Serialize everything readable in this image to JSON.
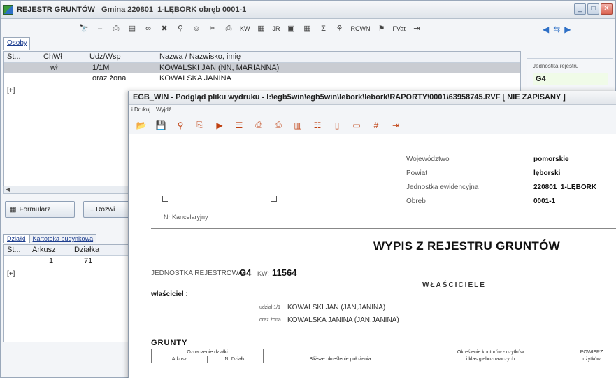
{
  "back_window": {
    "title": "REJESTR GRUNTÓW",
    "title_sub": "Gmina 220801_1-LĘBORK obręb 0001-1",
    "tab_osoby": "Osoby",
    "toolbar": {
      "kw_label": "KW",
      "jr_label": "JR",
      "rcwn_label": "RCWN",
      "fvat_label": "FVat"
    },
    "grid_columns": [
      "St...",
      "ChWł",
      "Udz/Wsp",
      "Nazwa / Nazwisko, imię"
    ],
    "grid_rows": [
      {
        "st": "",
        "chwl": "wł",
        "udz": "1/1M",
        "name": "KOWALSKI JAN (NN, MARIANNA)",
        "selected": true
      },
      {
        "st": "",
        "chwl": "",
        "udz": "oraz żona",
        "name": "KOWALSKA JANINA",
        "selected": false
      }
    ],
    "expand_marker": "[+]",
    "side_label": "Jednostka rejestru",
    "side_value": "G4",
    "btn_formularz": "Formularz",
    "btn_rozwin": "... Rozwi",
    "tabs2": [
      "Działki",
      "Kartoteka budynkowa"
    ],
    "grid2_columns": [
      "St...",
      "Arkusz",
      "Działka"
    ],
    "grid2_row": {
      "st": "",
      "arkusz": "1",
      "dzialka": "71"
    },
    "expand_marker2": "[+]"
  },
  "front_window": {
    "title": "EGB_WIN - Podgląd pliku wydruku - I:\\egb5win\\egb5win\\lebork\\lebork\\RAPORTY\\0001\\63958745.RVF [ NIE ZAPISANY ]",
    "menu": [
      "i Drukuj",
      "Wyjdź"
    ],
    "report": {
      "wojewodztwo_label": "Województwo",
      "wojewodztwo_value": "pomorskie",
      "powiat_label": "Powiat",
      "powiat_value": "lęborski",
      "jednostka_label": "Jednostka ewidencyjna",
      "jednostka_value": "220801_1-LĘBORK",
      "obreb_label": "Obręb",
      "obreb_value": "0001-1",
      "nr_kancelaryjny": "Nr Kancelaryjny",
      "heading": "WYPIS Z REJESTRU GRUNTÓW",
      "jednostka_rejestrowa_label": "JEDNOSTKA REJESTROWA :",
      "jednostka_rejestrowa_value": "G4",
      "kw_label": "KW:",
      "kw_value": "11564",
      "wlasciciele": "WŁAŚCICIELE",
      "wlasciciel_label": "właściciel :",
      "owners": [
        {
          "share": "udział 1/1",
          "name": "KOWALSKI JAN (JAN,JANINA)"
        },
        {
          "share": "oraz żona",
          "name": "KOWALSKA JANINA (JAN,JANINA)"
        }
      ],
      "grunty": "GRUNTY",
      "table_header_top": [
        "Oznaczenie działki",
        "Określenie konturów - użytków",
        "POWIERZ"
      ],
      "table_header_sub": [
        "Arkusz",
        "Nr Działki",
        "Bliższe określenie położenia",
        "i klas gleboznawczych",
        "użytków"
      ]
    }
  }
}
